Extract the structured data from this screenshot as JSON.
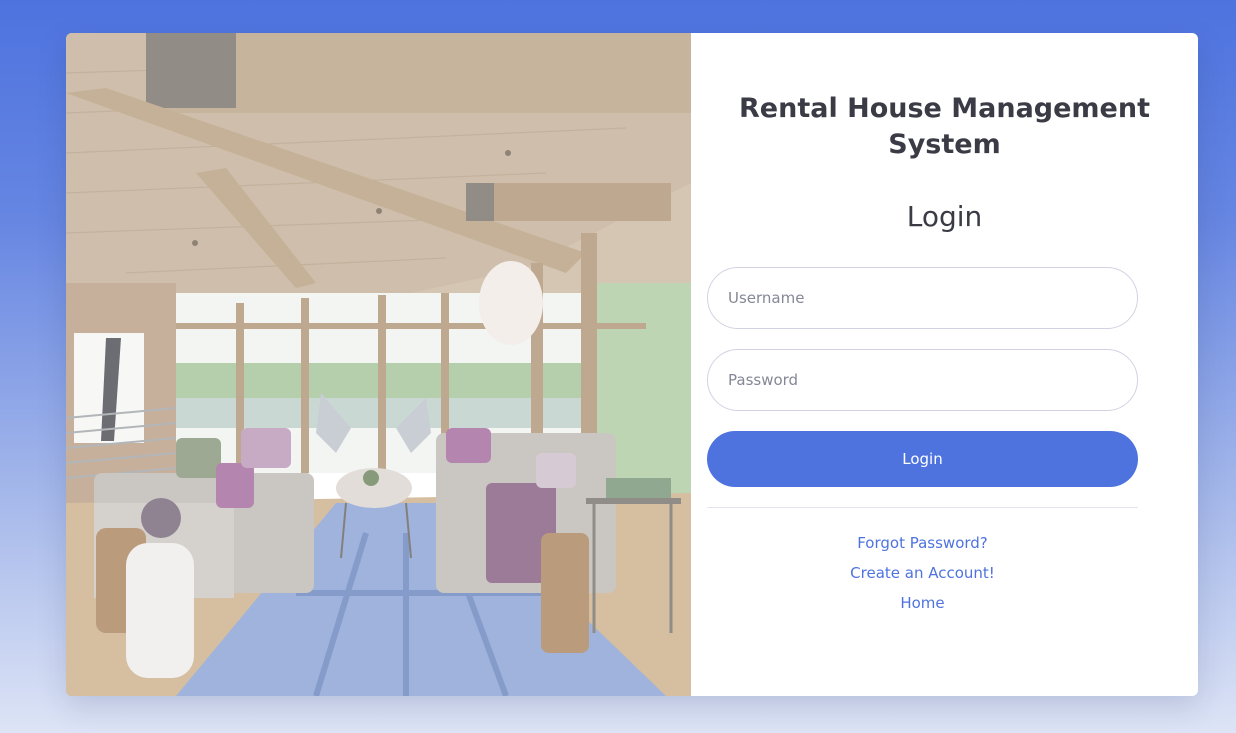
{
  "app": {
    "title": "Rental House Management System",
    "heading": "Login"
  },
  "form": {
    "username_placeholder": "Username",
    "password_placeholder": "Password",
    "submit_label": "Login"
  },
  "links": {
    "forgot": "Forgot Password?",
    "create": "Create an Account!",
    "home": "Home"
  },
  "colors": {
    "accent": "#4e73df",
    "text": "#3a3b45",
    "background": "#4e73df"
  },
  "image": {
    "subject": "living-room-photo"
  }
}
